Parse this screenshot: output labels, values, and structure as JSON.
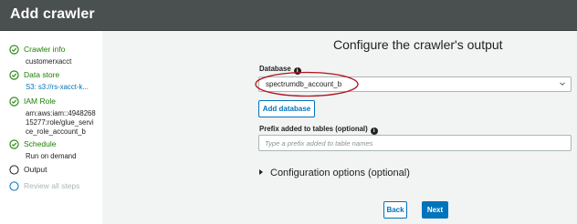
{
  "header": {
    "title": "Add crawler"
  },
  "sidebar": {
    "steps": [
      {
        "label": "Crawler info",
        "state": "complete",
        "details": [
          "customerxacct"
        ]
      },
      {
        "label": "Data store",
        "state": "complete",
        "details": [
          "S3: s3://rs-xacct-k..."
        ]
      },
      {
        "label": "IAM Role",
        "state": "complete",
        "details": [
          "arn:aws:iam::4948268",
          "15277:role/glue_servi",
          "ce_role_account_b"
        ]
      },
      {
        "label": "Schedule",
        "state": "complete",
        "details": [
          "Run on demand"
        ]
      },
      {
        "label": "Output",
        "state": "current",
        "details": []
      },
      {
        "label": "Review all steps",
        "state": "upcoming",
        "details": []
      }
    ]
  },
  "main": {
    "title": "Configure the crawler's output",
    "database": {
      "label": "Database",
      "value": "spectrumdb_account_b",
      "add_button": "Add database"
    },
    "prefix": {
      "label": "Prefix added to tables (optional)",
      "placeholder": "Type a prefix added to table names",
      "value": ""
    },
    "config_options": {
      "label": "Configuration options (optional)"
    },
    "buttons": {
      "back": "Back",
      "next": "Next"
    }
  },
  "colors": {
    "header_bg": "#4a4f4f",
    "complete": "#1d8102",
    "link": "#0073bb",
    "upcoming": "#aab7b8",
    "primary_button": "#0073bb",
    "annotation": "#b0151f"
  },
  "icons": {
    "complete_step": "check-circle-icon",
    "current_step": "empty-circle-icon",
    "info": "info-icon",
    "dropdown": "chevron-down-icon",
    "expand": "caret-right-icon"
  }
}
